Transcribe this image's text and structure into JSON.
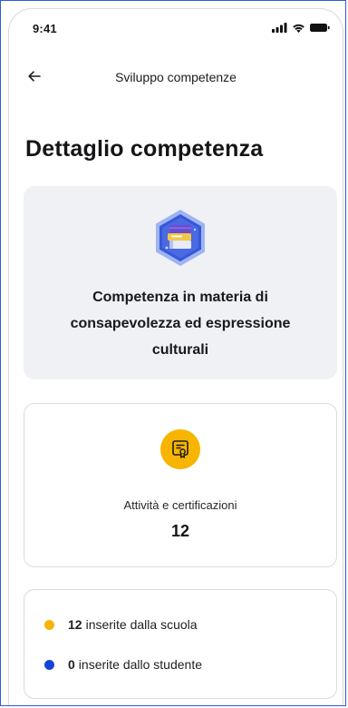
{
  "status_bar": {
    "time": "9:41",
    "icons": [
      "signal-icon",
      "wifi-icon",
      "battery-icon"
    ]
  },
  "nav": {
    "back_icon": "arrow-left-icon",
    "title": "Sviluppo competenze"
  },
  "page": {
    "title": "Dettaglio competenza"
  },
  "competence": {
    "badge_icon": "books-badge-icon",
    "name": "Competenza in materia di consapevolezza ed espressione culturali"
  },
  "stats": {
    "icon": "certificate-icon",
    "label": "Attività e certificazioni",
    "value": "12"
  },
  "breakdown": [
    {
      "count": "12",
      "label": "inserite dalla scuola",
      "color": "#f7b500"
    },
    {
      "count": "0",
      "label": "inserite dallo studente",
      "color": "#1545d6"
    }
  ],
  "colors": {
    "accent_yellow": "#f7b500",
    "accent_blue": "#1545d6",
    "card_background": "#f0f1f4",
    "frame_border": "#2f5bd6"
  }
}
